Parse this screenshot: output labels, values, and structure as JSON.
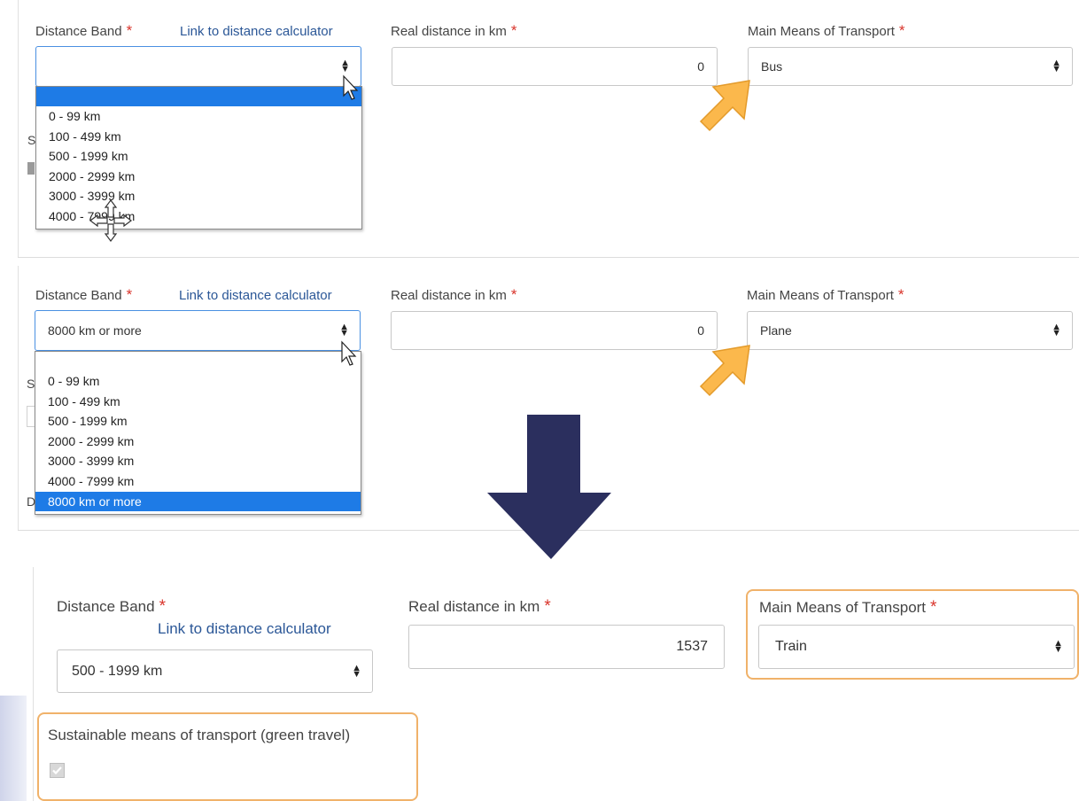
{
  "form1": {
    "distance_band_label": "Distance Band",
    "required_star": "*",
    "link_label": "Link to distance calculator",
    "real_distance_label": "Real distance in km",
    "real_distance_value": "0",
    "transport_label": "Main Means of Transport",
    "distance_band_value": "",
    "transport_value": "Bus",
    "dropdown_options": [
      "0 - 99 km",
      "100 - 499 km",
      "500 - 1999 km",
      "2000 - 2999 km",
      "3000 - 3999 km",
      "4000 - 7999 km"
    ],
    "clipped_letter": "S"
  },
  "form2": {
    "distance_band_label": "Distance Band",
    "required_star": "*",
    "link_label": "Link to distance calculator",
    "real_distance_label": "Real distance in km",
    "real_distance_value": "0",
    "transport_label": "Main Means of Transport",
    "distance_band_value": "8000 km or more",
    "transport_value": "Plane",
    "dropdown_options": [
      "0 - 99 km",
      "100 - 499 km",
      "500 - 1999 km",
      "2000 - 2999 km",
      "3000 - 3999 km",
      "4000 - 7999 km",
      "8000 km or more"
    ],
    "clipped_letter_s": "S",
    "clipped_letter_d": "D"
  },
  "form3": {
    "distance_band_label": "Distance Band",
    "required_star": "*",
    "link_label": "Link to distance calculator",
    "real_distance_label": "Real distance in km",
    "real_distance_value": "1537",
    "transport_label": "Main Means of Transport",
    "distance_band_value": "500 - 1999 km",
    "transport_value": "Train",
    "sustainable_label": "Sustainable means of transport (green travel)",
    "sustainable_checked": true
  },
  "colors": {
    "accent_blue": "#1e7be6",
    "link_blue": "#2b5797",
    "required_red": "#d9342b",
    "highlight_orange": "#f0b26a",
    "pointer_arrow": "#fbb84c",
    "down_arrow": "#2b2f5e"
  }
}
